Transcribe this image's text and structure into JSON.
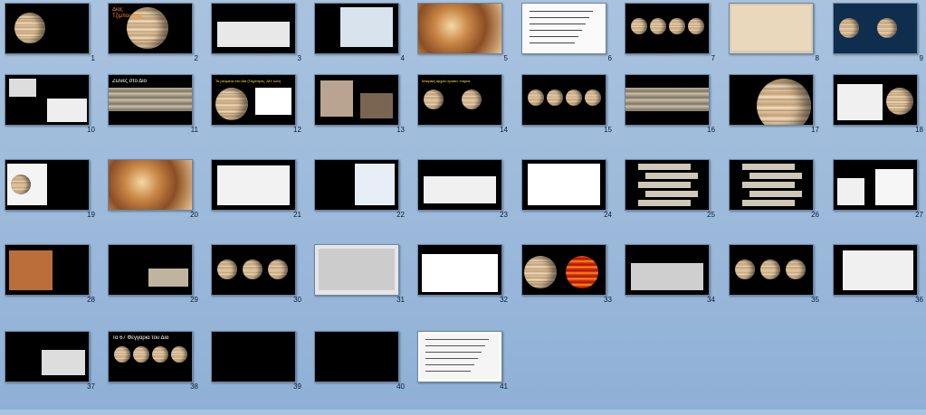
{
  "view": "slide-sorter",
  "slides": [
    {
      "number": "1",
      "text": []
    },
    {
      "number": "2",
      "text": [
        {
          "s": "Δίας\nΤζιμπουρκας",
          "c": "orange"
        }
      ]
    },
    {
      "number": "3",
      "text": []
    },
    {
      "number": "4",
      "text": []
    },
    {
      "number": "5",
      "text": []
    },
    {
      "number": "6",
      "text": []
    },
    {
      "number": "7",
      "text": []
    },
    {
      "number": "8",
      "text": []
    },
    {
      "number": "9",
      "text": []
    },
    {
      "number": "10",
      "text": []
    },
    {
      "number": "11",
      "text": [
        {
          "s": "Ζώνες στο Δίο",
          "c": "white"
        }
      ]
    },
    {
      "number": "12",
      "text": [
        {
          "s": "Τα ρεύματα στο Δία (Ταχύτητες, ΔΗ, κλπ)",
          "c": "yellow"
        }
      ]
    },
    {
      "number": "13",
      "text": []
    },
    {
      "number": "14",
      "text": [
        {
          "s": "Ιστορική αρχείο ερασιτ. παρατ.",
          "c": "yellow"
        }
      ]
    },
    {
      "number": "15",
      "text": []
    },
    {
      "number": "16",
      "text": []
    },
    {
      "number": "17",
      "text": []
    },
    {
      "number": "18",
      "text": []
    },
    {
      "number": "19",
      "text": []
    },
    {
      "number": "20",
      "text": []
    },
    {
      "number": "21",
      "text": []
    },
    {
      "number": "22",
      "text": []
    },
    {
      "number": "23",
      "text": []
    },
    {
      "number": "24",
      "text": []
    },
    {
      "number": "25",
      "text": []
    },
    {
      "number": "26",
      "text": []
    },
    {
      "number": "27",
      "text": []
    },
    {
      "number": "28",
      "text": []
    },
    {
      "number": "29",
      "text": []
    },
    {
      "number": "30",
      "text": []
    },
    {
      "number": "31",
      "text": []
    },
    {
      "number": "32",
      "text": []
    },
    {
      "number": "33",
      "text": []
    },
    {
      "number": "34",
      "text": []
    },
    {
      "number": "35",
      "text": []
    },
    {
      "number": "36",
      "text": []
    },
    {
      "number": "37",
      "text": []
    },
    {
      "number": "38",
      "text": [
        {
          "s": "Τα 67 Φεγγάρια του Δία",
          "c": "white"
        }
      ]
    },
    {
      "number": "39",
      "text": []
    },
    {
      "number": "40",
      "text": []
    },
    {
      "number": "41",
      "text": []
    }
  ],
  "colors": {
    "background": "#9dbadb",
    "thumb_border": "#6e86a3",
    "slide_black": "#000000",
    "accent_yellow": "#ffe03a"
  }
}
